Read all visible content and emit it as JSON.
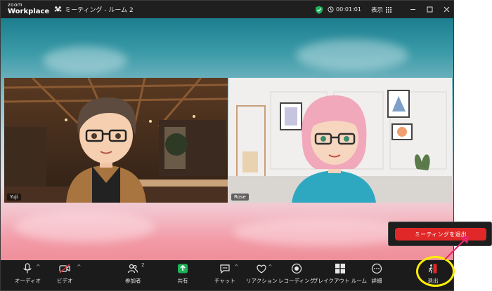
{
  "app": {
    "logo_line1": "zoom",
    "logo_line2": "Workplace",
    "room_title": "ミーティング - ルーム 2",
    "timer": "00:01:01",
    "view_label": "表示"
  },
  "participants": [
    {
      "name": "Yuji"
    },
    {
      "name": "Rose"
    }
  ],
  "toolbar": {
    "audio": "オーディオ",
    "video": "ビデオ",
    "participants": "参加者",
    "participants_count": "2",
    "share": "共有",
    "chat": "チャット",
    "reactions": "リアクション",
    "record": "レコーディング",
    "breakout": "ブレイクアウト ルーム",
    "more": "詳細",
    "leave": "退出"
  },
  "leave_popup": {
    "button_label": "ミーティングを退出"
  },
  "colors": {
    "leave_red": "#e02828",
    "highlight_yellow": "#ffee00",
    "arrow_pink": "#e8246c",
    "share_green": "#1fb35a",
    "shield_green": "#1fb35a"
  }
}
